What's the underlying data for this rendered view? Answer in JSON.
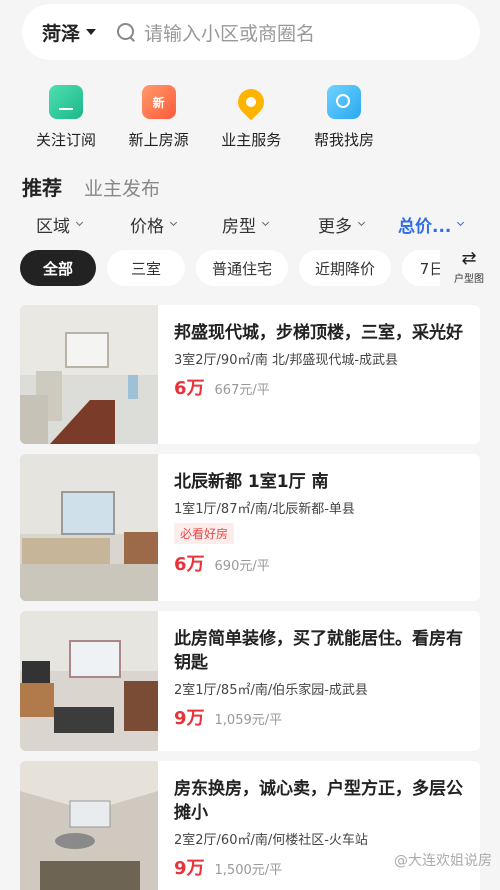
{
  "search": {
    "city": "菏泽",
    "placeholder": "请输入小区或商圈名"
  },
  "quick": [
    {
      "label": "关注订阅",
      "icon": "subscribe-icon"
    },
    {
      "label": "新上房源",
      "icon": "new-badge-icon",
      "badge": "新"
    },
    {
      "label": "业主服务",
      "icon": "location-pin-icon"
    },
    {
      "label": "帮我找房",
      "icon": "find-house-icon"
    }
  ],
  "feed_tabs": [
    "推荐",
    "业主发布"
  ],
  "filters": [
    "区域",
    "价格",
    "房型",
    "更多",
    "总价..."
  ],
  "chips": [
    "全部",
    "三室",
    "普通住宅",
    "近期降价",
    "7日"
  ],
  "layout_toggle": {
    "label": "户型图"
  },
  "listings": [
    {
      "title": "邦盛现代城，步梯顶楼，三室，采光好",
      "sub": "3室2厅/90㎡/南 北/邦盛现代城-成武县",
      "tag": "",
      "price": "6万",
      "unit_price": "667元/平"
    },
    {
      "title": "北辰新都 1室1厅 南",
      "sub": "1室1厅/87㎡/南/北辰新都-单县",
      "tag": "必看好房",
      "price": "6万",
      "unit_price": "690元/平"
    },
    {
      "title": "此房简单装修，买了就能居住。看房有钥匙",
      "sub": "2室1厅/85㎡/南/伯乐家园-成武县",
      "tag": "",
      "price": "9万",
      "unit_price": "1,059元/平"
    },
    {
      "title": "房东换房，诚心卖，户型方正，多层公摊小",
      "sub": "2室2厅/60㎡/南/何楼社区-火车站",
      "tag": "",
      "price": "9万",
      "unit_price": "1,500元/平"
    }
  ],
  "watermark": "@大连欢姐说房",
  "colors": {
    "accent_blue": "#2f6ce5",
    "price_red": "#e8333a"
  }
}
